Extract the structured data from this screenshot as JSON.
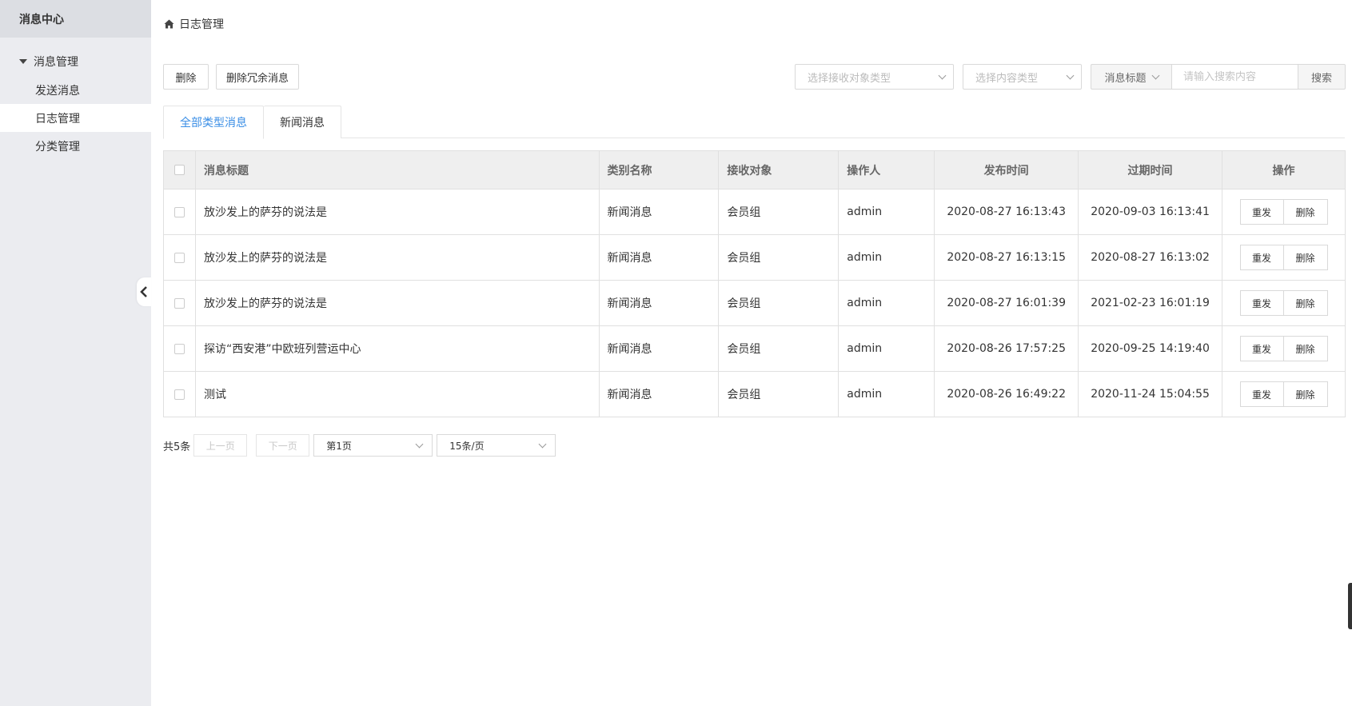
{
  "sidebar": {
    "title": "消息中心",
    "group_label": "消息管理",
    "items": [
      {
        "label": "发送消息"
      },
      {
        "label": "日志管理"
      },
      {
        "label": "分类管理"
      }
    ]
  },
  "breadcrumb": {
    "label": "日志管理"
  },
  "toolbar": {
    "delete_label": "删除",
    "delete_redundant_label": "删除冗余消息",
    "receiver_type_placeholder": "选择接收对象类型",
    "content_type_placeholder": "选择内容类型",
    "search_field": "消息标题",
    "search_placeholder": "请输入搜索内容",
    "search_label": "搜索"
  },
  "tabs": [
    {
      "label": "全部类型消息"
    },
    {
      "label": "新闻消息"
    }
  ],
  "table": {
    "headers": [
      "消息标题",
      "类别名称",
      "接收对象",
      "操作人",
      "发布时间",
      "过期时间",
      "操作"
    ],
    "rows": [
      {
        "title": "放沙发上的萨芬的说法是",
        "category": "新闻消息",
        "receiver": "会员组",
        "operator": "admin",
        "publish": "2020-08-27 16:13:43",
        "expire": "2020-09-03 16:13:41"
      },
      {
        "title": "放沙发上的萨芬的说法是",
        "category": "新闻消息",
        "receiver": "会员组",
        "operator": "admin",
        "publish": "2020-08-27 16:13:15",
        "expire": "2020-08-27 16:13:02"
      },
      {
        "title": "放沙发上的萨芬的说法是",
        "category": "新闻消息",
        "receiver": "会员组",
        "operator": "admin",
        "publish": "2020-08-27 16:01:39",
        "expire": "2021-02-23 16:01:19"
      },
      {
        "title": "探访“西安港”中欧班列营运中心",
        "category": "新闻消息",
        "receiver": "会员组",
        "operator": "admin",
        "publish": "2020-08-26 17:57:25",
        "expire": "2020-09-25 14:19:40"
      },
      {
        "title": "测试",
        "category": "新闻消息",
        "receiver": "会员组",
        "operator": "admin",
        "publish": "2020-08-26 16:49:22",
        "expire": "2020-11-24 15:04:55"
      }
    ],
    "resend_label": "重发",
    "row_delete_label": "删除"
  },
  "pagination": {
    "total": "共5条",
    "prev": "上一页",
    "next": "下一页",
    "page": "第1页",
    "page_size": "15条/页"
  }
}
